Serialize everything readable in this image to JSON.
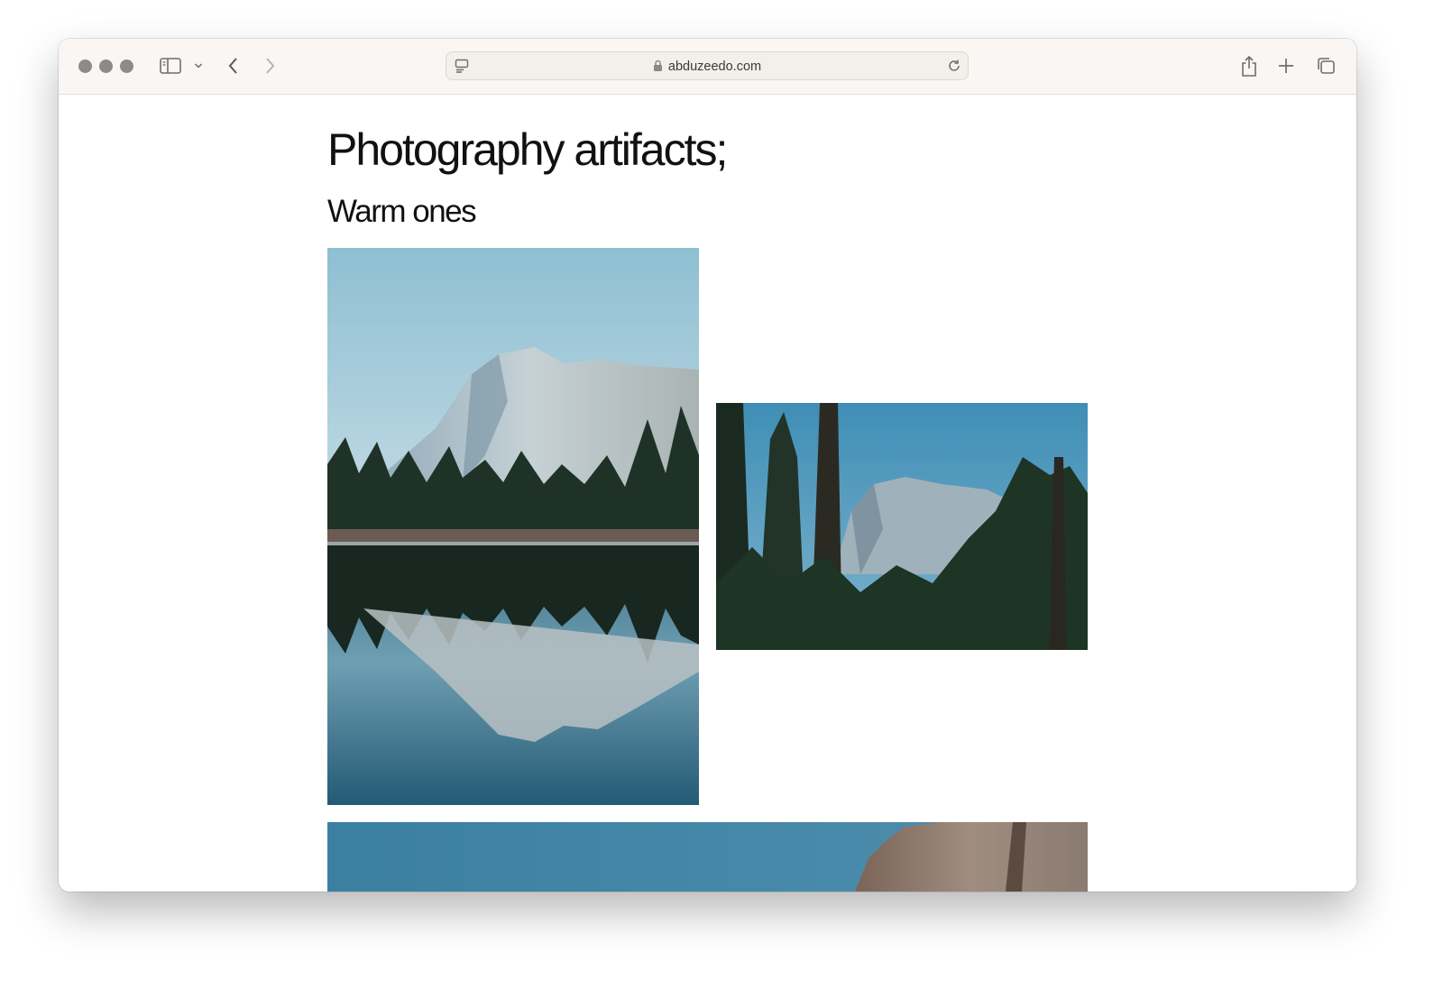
{
  "browser": {
    "url": "abduzeedo.com",
    "buttons": [
      "close",
      "minimize",
      "zoom",
      "sidebar",
      "back",
      "forward",
      "share",
      "new-tab",
      "tab-overview"
    ]
  },
  "article": {
    "title": "Photography artifacts;",
    "section_heading": "Warm ones",
    "photos": [
      {
        "id": "half-dome-reflection",
        "subject": "mountain reflected in lake"
      },
      {
        "id": "half-dome-through-pines",
        "subject": "mountain framed by pine trees"
      },
      {
        "id": "granite-cliff-partial",
        "subject": "granite cliff against blue sky"
      }
    ]
  },
  "colors": {
    "toolbar_bg": "#f9f6f3",
    "sky_blue": "#7db3c8",
    "lake_blue": "#3d7d9a",
    "forest_dark": "#1f3227"
  }
}
